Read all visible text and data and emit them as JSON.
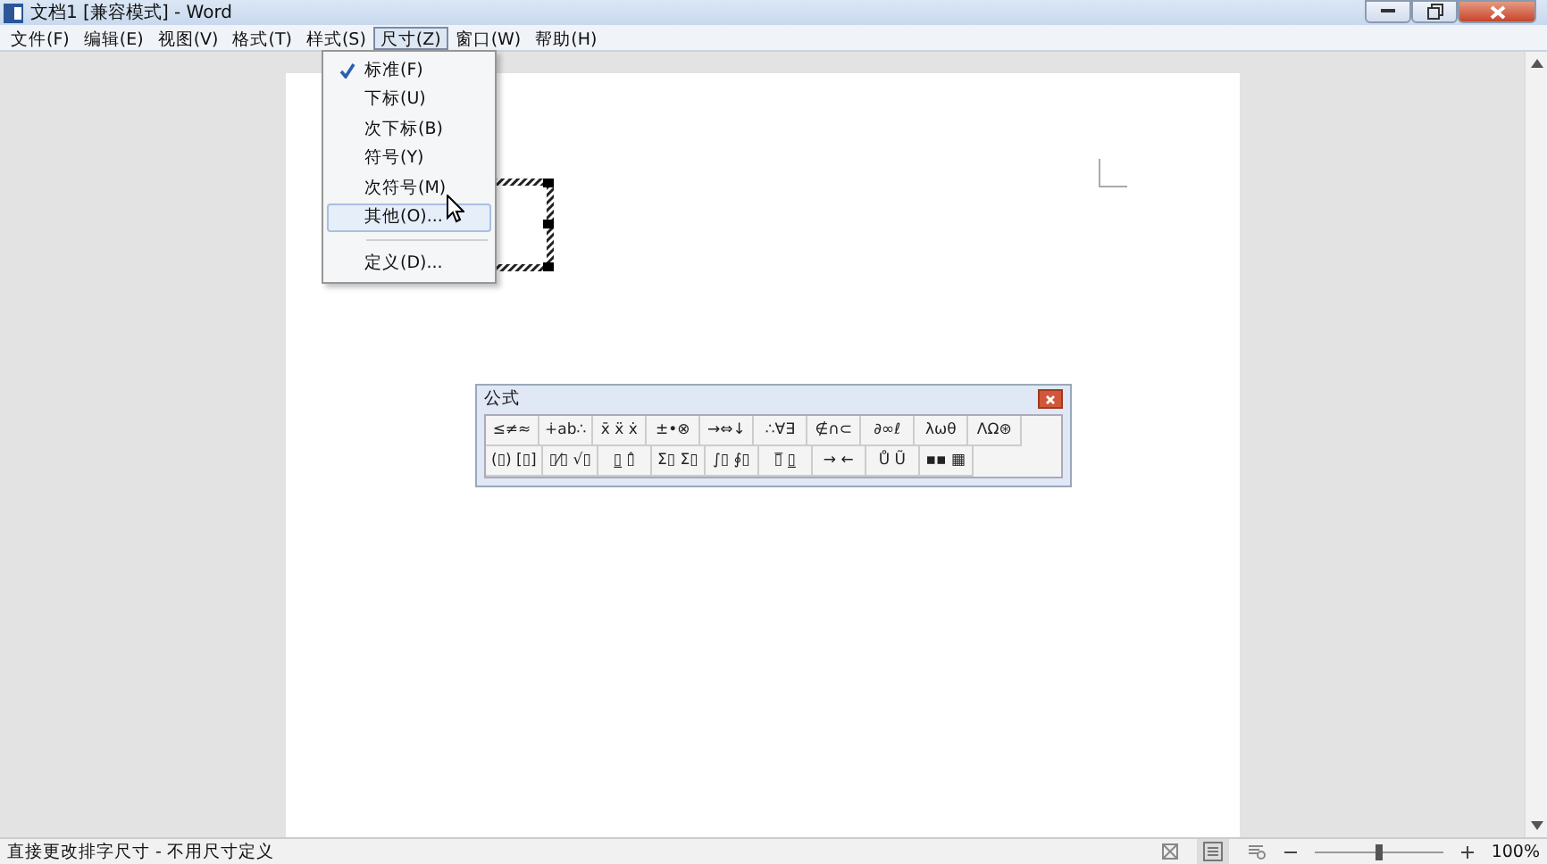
{
  "window": {
    "title": "文档1 [兼容模式] - Word"
  },
  "menubar": [
    {
      "label": "文件(F)",
      "selected": false
    },
    {
      "label": "编辑(E)",
      "selected": false
    },
    {
      "label": "视图(V)",
      "selected": false
    },
    {
      "label": "格式(T)",
      "selected": false
    },
    {
      "label": "样式(S)",
      "selected": false
    },
    {
      "label": "尺寸(Z)",
      "selected": true
    },
    {
      "label": "窗口(W)",
      "selected": false
    },
    {
      "label": "帮助(H)",
      "selected": false
    }
  ],
  "size_menu": {
    "items": [
      {
        "label": "标准(F)",
        "checked": true,
        "selected": false,
        "kind": "item"
      },
      {
        "label": "下标(U)",
        "checked": false,
        "selected": false,
        "kind": "item"
      },
      {
        "label": "次下标(B)",
        "checked": false,
        "selected": false,
        "kind": "item"
      },
      {
        "label": "符号(Y)",
        "checked": false,
        "selected": false,
        "kind": "item"
      },
      {
        "label": "次符号(M)",
        "checked": false,
        "selected": false,
        "kind": "item"
      },
      {
        "label": "其他(O)...",
        "checked": false,
        "selected": true,
        "kind": "item"
      },
      {
        "kind": "separator"
      },
      {
        "label": "定义(D)...",
        "checked": false,
        "selected": false,
        "kind": "item"
      }
    ]
  },
  "equation_palette": {
    "title": "公式",
    "rows": [
      [
        "≤≠≈",
        "∔ab∴",
        "x̄ ẍ ẋ",
        "±•⊗",
        "→⇔↓",
        "∴∀∃",
        "∉∩⊂",
        "∂∞ℓ",
        "λωθ",
        "ΛΩ⊛"
      ],
      [
        "(▯) [▯]",
        "▯⁄▯ √▯",
        "▯̲ ▯̂",
        "Σ▯ Σ▯",
        "∫▯ ∮▯",
        "▯̅ ▯̲",
        "→ ←",
        "Ů Ũ",
        "▪▪ ▦"
      ]
    ]
  },
  "status_bar": {
    "text": "直接更改排字尺寸 - 不用尺寸定义",
    "zoom": {
      "level": 0.5,
      "label": "100%"
    }
  }
}
